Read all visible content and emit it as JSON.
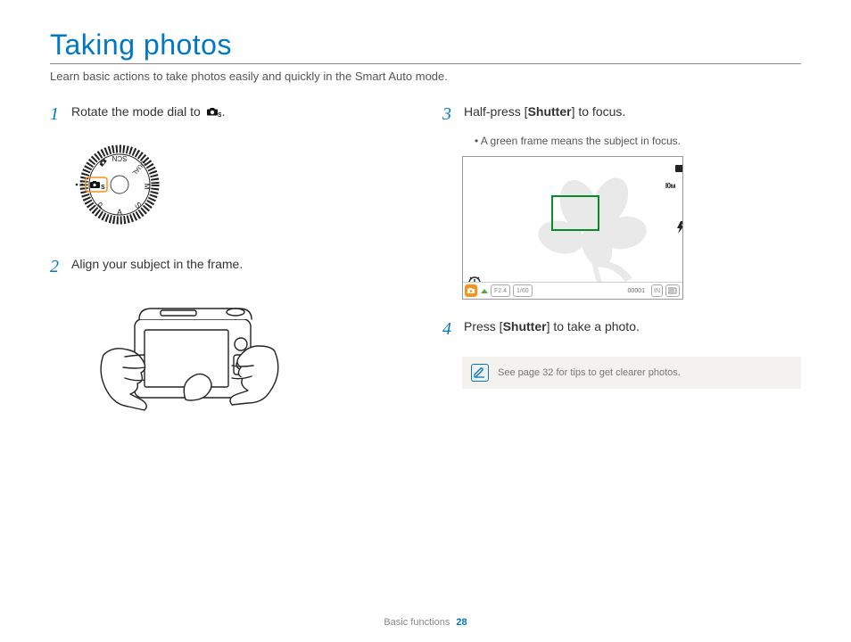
{
  "title": "Taking photos",
  "subtitle": "Learn basic actions to take photos easily and quickly in the Smart Auto mode.",
  "steps": {
    "s1": {
      "num": "1",
      "pre": "Rotate the mode dial to ",
      "post": "."
    },
    "s2": {
      "num": "2",
      "text": "Align your subject in the frame."
    },
    "s3": {
      "num": "3",
      "pre": "Half-press [",
      "bold": "Shutter",
      "post": "] to focus.",
      "bullet": "A green frame means the subject in focus."
    },
    "s4": {
      "num": "4",
      "pre": "Press [",
      "bold": "Shutter",
      "post": "] to take a photo."
    }
  },
  "dial": {
    "modes": [
      "SCN",
      "DUAL",
      "M",
      "S",
      "A",
      "P"
    ],
    "selected": "S"
  },
  "lcd": {
    "aperture": "F2.4",
    "shutter": "1/60",
    "counter": "00001",
    "icons": {
      "battery": "battery-icon",
      "res": "10M",
      "flash": "flash-auto-icon",
      "stabilizer": "stabilizer-icon",
      "storage": "IN",
      "card": "card-icon"
    }
  },
  "tip": "See page 32 for tips to get clearer photos.",
  "footer": {
    "section": "Basic functions",
    "page": "28"
  }
}
